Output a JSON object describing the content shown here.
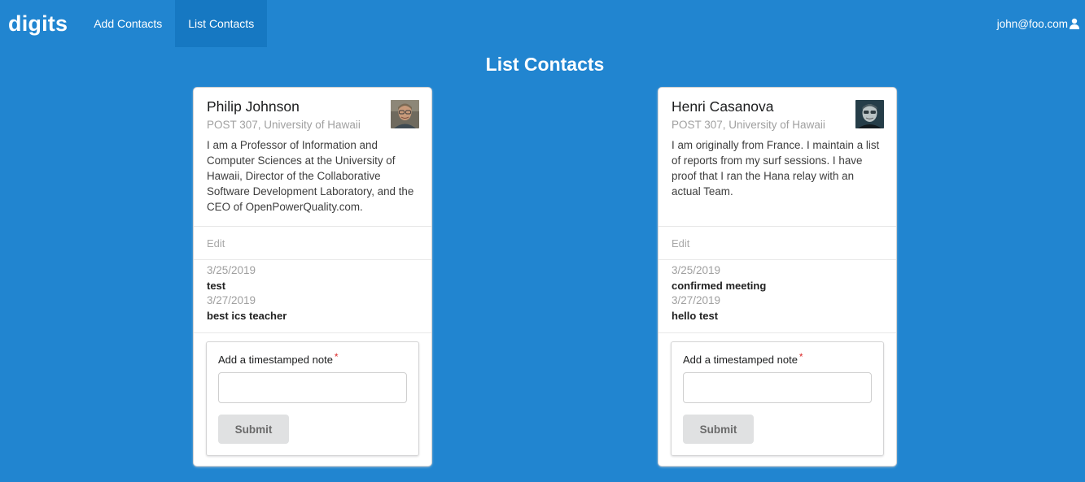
{
  "navbar": {
    "brand": "digits",
    "items": [
      {
        "label": "Add Contacts",
        "active": false
      },
      {
        "label": "List Contacts",
        "active": true
      }
    ],
    "user": "john@foo.com"
  },
  "page": {
    "title": "List Contacts"
  },
  "contacts": [
    {
      "name": "Philip Johnson",
      "address": "POST 307, University of Hawaii",
      "description": "I am a Professor of Information and Computer Sciences at the University of Hawaii, Director of the Collaborative Software Development Laboratory, and the CEO of OpenPowerQuality.com.",
      "edit_label": "Edit",
      "notes": [
        {
          "date": "3/25/2019",
          "text": "test"
        },
        {
          "date": "3/27/2019",
          "text": "best ics teacher"
        }
      ],
      "form": {
        "label": "Add a timestamped note",
        "required_mark": "*",
        "value": "",
        "submit_label": "Submit"
      }
    },
    {
      "name": "Henri Casanova",
      "address": "POST 307, University of Hawaii",
      "description": "I am originally from France. I maintain a list of reports from my surf sessions. I have proof that I ran the Hana relay with an actual Team.",
      "edit_label": "Edit",
      "notes": [
        {
          "date": "3/25/2019",
          "text": "confirmed meeting"
        },
        {
          "date": "3/27/2019",
          "text": "hello test"
        }
      ],
      "form": {
        "label": "Add a timestamped note",
        "required_mark": "*",
        "value": "",
        "submit_label": "Submit"
      }
    }
  ],
  "colors": {
    "background": "#2185d0",
    "active_nav": "#1678c2",
    "required": "#db2828"
  }
}
